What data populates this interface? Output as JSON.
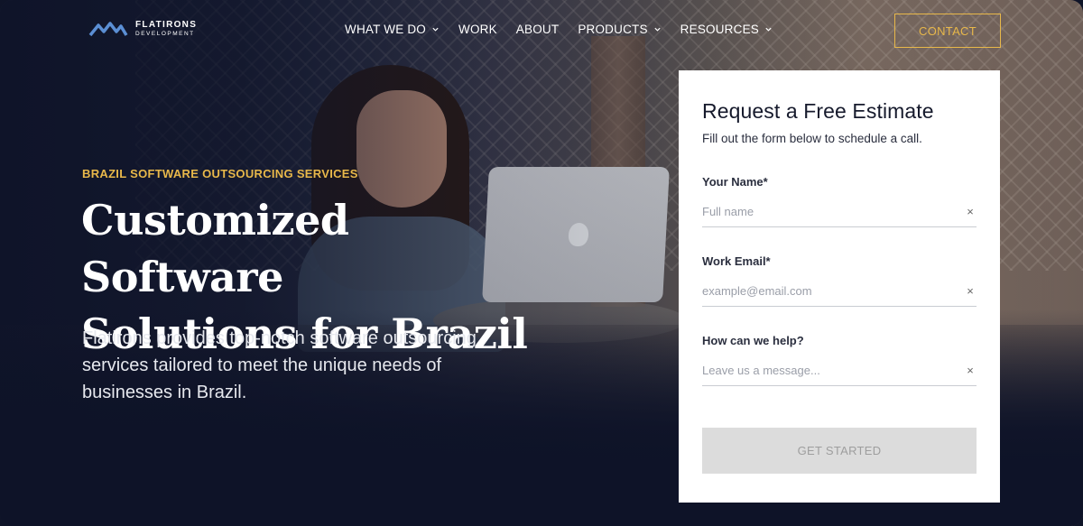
{
  "brand": {
    "name_line1": "FLATIRONS",
    "name_line2": "DEVELOPMENT",
    "accent": "#e8b84a",
    "logo_color": "#5b8fd4"
  },
  "nav": {
    "items": [
      {
        "label": "WHAT WE DO",
        "has_dropdown": true
      },
      {
        "label": "WORK",
        "has_dropdown": false
      },
      {
        "label": "ABOUT",
        "has_dropdown": false
      },
      {
        "label": "PRODUCTS",
        "has_dropdown": true
      },
      {
        "label": "RESOURCES",
        "has_dropdown": true
      }
    ],
    "contact_label": "CONTACT"
  },
  "hero": {
    "eyebrow": "BRAZIL SOFTWARE OUTSOURCING SERVICES",
    "headline_line1": "Customized Software",
    "headline_line2": "Solutions for Brazil",
    "lede": "Flatirons provides top-notch software outsourcing services tailored to meet the unique needs of businesses in Brazil."
  },
  "form": {
    "title": "Request a Free Estimate",
    "subtitle": "Fill out the form below to schedule a call.",
    "fields": [
      {
        "label": "Your Name*",
        "placeholder": "Full name",
        "value": ""
      },
      {
        "label": "Work Email*",
        "placeholder": "example@email.com",
        "value": ""
      },
      {
        "label": "How can we help?",
        "placeholder": "Leave us a message...",
        "value": ""
      }
    ],
    "clear_icon": "×",
    "submit_label": "GET STARTED"
  }
}
